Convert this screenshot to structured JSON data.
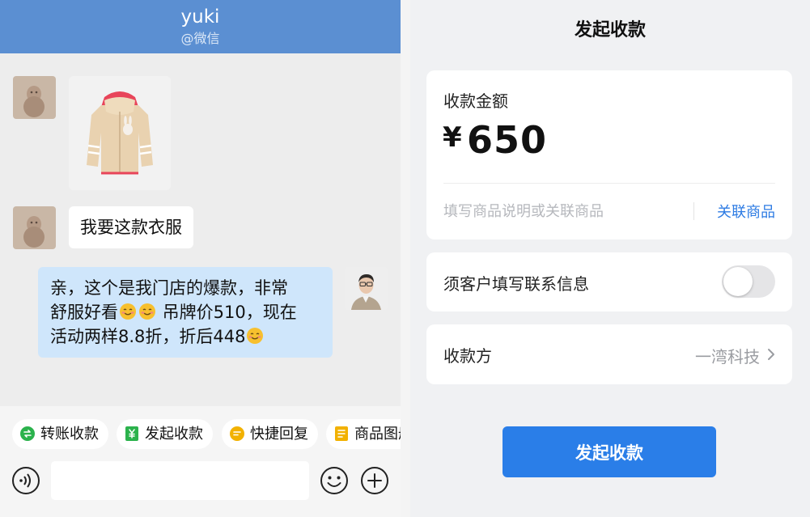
{
  "chat": {
    "title": "yuki",
    "subtitle": "@微信",
    "messages": [
      {
        "from": "customer",
        "type": "image",
        "image_name": "product-jacket-image"
      },
      {
        "from": "customer",
        "type": "text",
        "text": "我要这款衣服"
      },
      {
        "from": "merchant",
        "type": "text",
        "line1": "亲，这个是我门店的爆款，非常",
        "line2a": "舒服好看",
        "line2b": " 吊牌价510，现在",
        "line3a": "活动两样8.8折，折后448"
      }
    ],
    "quick_actions": [
      {
        "label": "转账收款",
        "icon": "transfer-icon",
        "color": "#2bb24c"
      },
      {
        "label": "发起收款",
        "icon": "yuan-icon",
        "color": "#2bb24c"
      },
      {
        "label": "快捷回复",
        "icon": "quick-reply-icon",
        "color": "#f2b100"
      },
      {
        "label": "商品图册",
        "icon": "catalog-icon",
        "color": "#f2b100"
      }
    ],
    "input": {
      "placeholder": ""
    }
  },
  "payment": {
    "title": "发起收款",
    "amount_label": "收款金额",
    "currency": "¥",
    "amount": "650",
    "description_placeholder": "填写商品说明或关联商品",
    "link_product_label": "关联商品",
    "require_contact_label": "须客户填写联系信息",
    "require_contact_enabled": false,
    "payee_label": "收款方",
    "payee_value": "一湾科技",
    "submit_label": "发起收款"
  },
  "colors": {
    "header_blue": "#5b8fd2",
    "bubble_blue": "#cfe6fb",
    "accent_blue": "#2a7ee8",
    "link_blue": "#2d7be3",
    "green": "#2bb24c",
    "yellow": "#f2b100"
  }
}
